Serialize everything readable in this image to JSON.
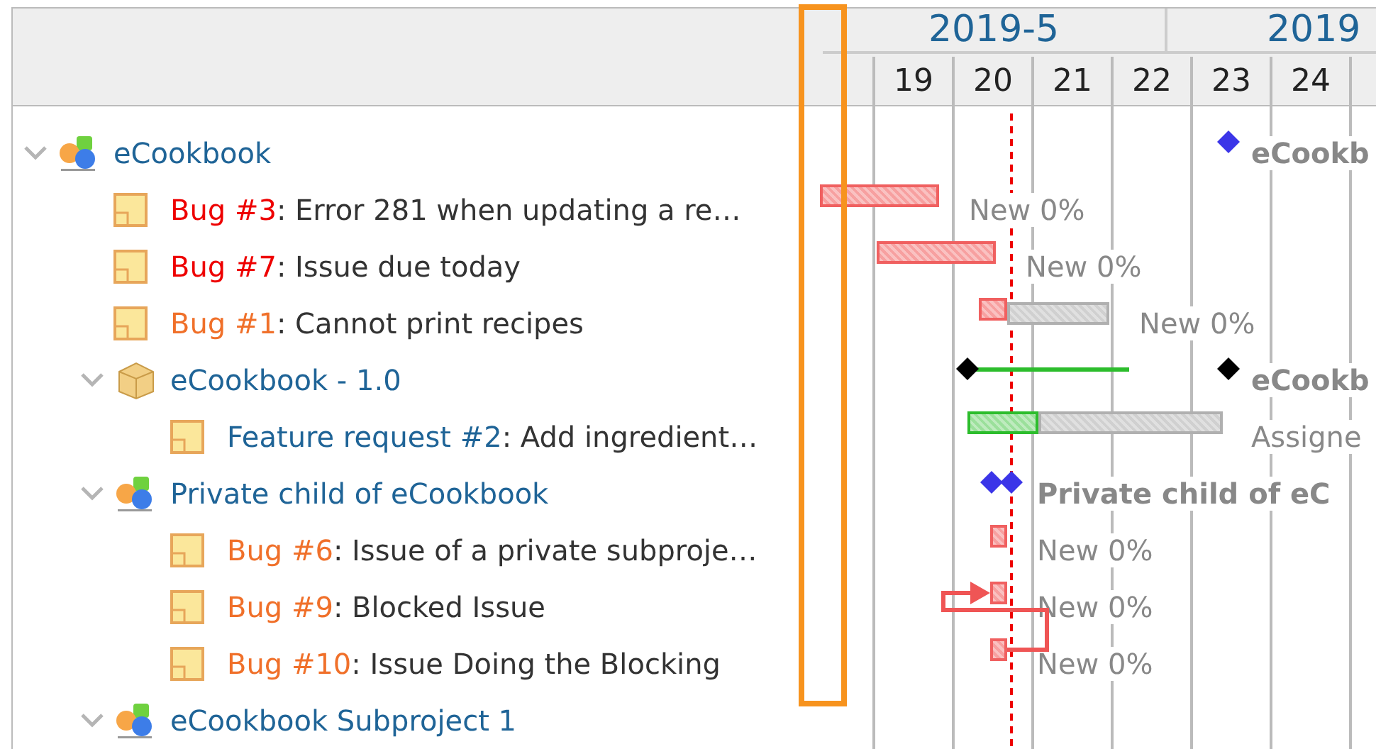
{
  "timeline": {
    "months": [
      "2019-5",
      "2019"
    ],
    "days": [
      "19",
      "20",
      "21",
      "22",
      "23",
      "24"
    ]
  },
  "tree": [
    {
      "kind": "project",
      "label": "eCookbook",
      "expanded": true,
      "gantt": {
        "label": "eCookb"
      },
      "children": [
        {
          "kind": "issue",
          "tracker": "Bug #3",
          "color": "#ee0000",
          "subject": ": Error 281 when updating a re…",
          "gantt": {
            "label": "New 0%"
          }
        },
        {
          "kind": "issue",
          "tracker": "Bug #7",
          "color": "#ee0000",
          "subject": ": Issue due today",
          "gantt": {
            "label": "New 0%"
          }
        },
        {
          "kind": "issue",
          "tracker": "Bug #1",
          "color": "#f0702a",
          "subject": ": Cannot print recipes",
          "gantt": {
            "label": "New 0%"
          }
        },
        {
          "kind": "version",
          "label": "eCookbook - 1.0",
          "expanded": true,
          "gantt": {
            "label": "eCookb"
          },
          "children": [
            {
              "kind": "issue",
              "tracker": "Feature request #2",
              "color": "#1f6497",
              "subject": ": Add ingredient…",
              "gantt": {
                "label": "Assigne"
              }
            }
          ]
        },
        {
          "kind": "project",
          "label": "Private child of eCookbook",
          "expanded": true,
          "gantt": {
            "label": "Private child of eC"
          },
          "children": [
            {
              "kind": "issue",
              "tracker": "Bug #6",
              "color": "#f0702a",
              "subject": ": Issue of a private subproje…",
              "gantt": {
                "label": "New 0%"
              }
            },
            {
              "kind": "issue",
              "tracker": "Bug #9",
              "color": "#f0702a",
              "subject": ": Blocked Issue",
              "gantt": {
                "label": "New 0%"
              }
            },
            {
              "kind": "issue",
              "tracker": "Bug #10",
              "color": "#f0702a",
              "subject": ": Issue Doing the Blocking",
              "gantt": {
                "label": "New 0%"
              }
            }
          ]
        },
        {
          "kind": "project",
          "label": "eCookbook Subproject 1",
          "expanded": true
        }
      ]
    }
  ]
}
